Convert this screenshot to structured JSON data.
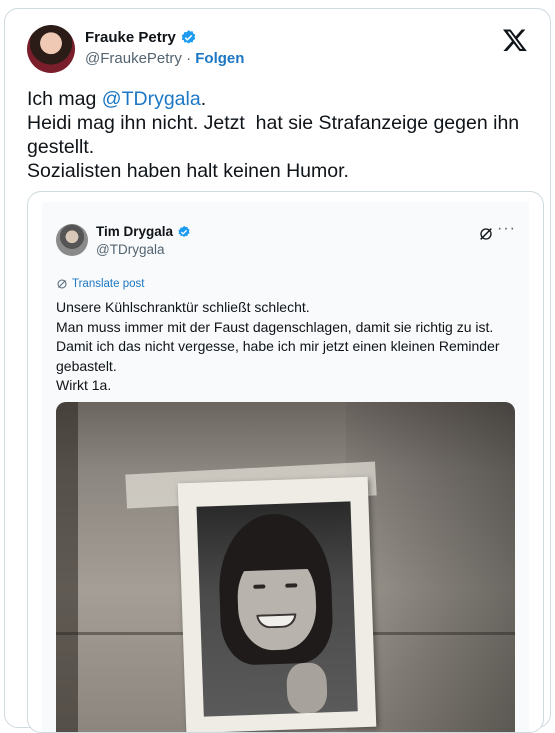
{
  "author": {
    "display_name": "Frauke Petry",
    "handle": "@FraukePetry",
    "separator": " · ",
    "follow_label": "Folgen"
  },
  "tweet": {
    "line1_prefix": "Ich mag ",
    "line1_mention": "@TDrygala",
    "line1_suffix": ".",
    "line2": "Heidi mag ihn nicht. Jetzt  hat sie Strafanzeige gegen ihn gestellt.",
    "line3": "Sozialisten haben halt keinen Humor."
  },
  "quoted": {
    "display_name": "Tim Drygala",
    "handle": "@TDrygala",
    "translate_label": "Translate post",
    "more_label": "···",
    "lines": [
      "Unsere Kühlschranktür schließt schlecht.",
      "Man muss immer mit der Faust dagenschlagen, damit sie richtig zu ist.",
      "Damit ich das nicht vergesse, habe ich mir jetzt einen kleinen Reminder gebastelt.",
      "Wirkt 1a."
    ]
  },
  "icons": {
    "verified": "verified-badge-icon",
    "x_logo": "x-logo-icon",
    "grok": "grok-icon",
    "translate": "translate-icon"
  },
  "colors": {
    "link": "#1d77c4",
    "verified": "#1d9bf0",
    "secondary_text": "#536471",
    "border": "#cfd9de"
  }
}
